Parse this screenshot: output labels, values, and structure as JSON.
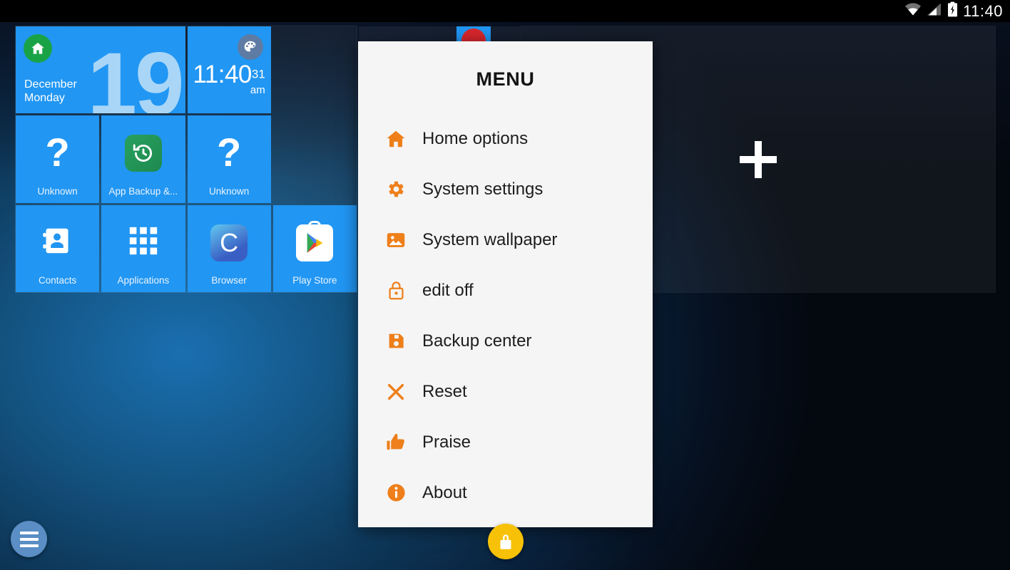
{
  "status_bar": {
    "clock": "11:40",
    "icons": [
      "wifi-icon",
      "signal-bars-icon",
      "battery-charging-icon"
    ]
  },
  "colors": {
    "tile_blue": "#2196f3",
    "menu_accent_orange": "#ee7f1a",
    "home_badge_green": "#1aa346",
    "lock_fab_amber": "#f7c107",
    "menu_fab_blue": "#5a8ec4",
    "dialog_bg": "#f5f5f5",
    "date_number": "#a9d6f7"
  },
  "home_screen": {
    "date_widget": {
      "icon": "home-icon",
      "month": "December",
      "weekday": "Monday",
      "day_number": "19"
    },
    "clock_widget": {
      "icon": "palette-icon",
      "time": "11:40",
      "seconds": "31",
      "meridiem": "am"
    },
    "tiles": [
      {
        "label": "Unknown",
        "icon": "question-mark-icon"
      },
      {
        "label": "App Backup &...",
        "icon": "app-backup-restore-icon"
      },
      {
        "label": "Unknown",
        "icon": "question-mark-icon"
      },
      {
        "label": "Contacts",
        "icon": "contacts-icon"
      },
      {
        "label": "Applications",
        "icon": "applications-grid-icon"
      },
      {
        "label": "Browser",
        "icon": "browser-icon"
      },
      {
        "label": "Play Store",
        "icon": "play-store-icon"
      }
    ],
    "add_page": {
      "icon": "plus-icon"
    }
  },
  "menu_dialog": {
    "title": "MENU",
    "items": [
      {
        "label": "Home options",
        "icon": "home-icon"
      },
      {
        "label": "System settings",
        "icon": "gear-icon"
      },
      {
        "label": "System wallpaper",
        "icon": "image-icon"
      },
      {
        "label": "edit off",
        "icon": "lock-icon"
      },
      {
        "label": "Backup center",
        "icon": "floppy-save-icon"
      },
      {
        "label": "Reset",
        "icon": "close-x-icon"
      },
      {
        "label": "Praise",
        "icon": "thumbs-up-icon"
      },
      {
        "label": "About",
        "icon": "info-icon"
      }
    ]
  },
  "floating_buttons": {
    "menu_fab": {
      "icon": "hamburger-menu-icon"
    },
    "lock_fab": {
      "icon": "padlock-icon"
    }
  }
}
